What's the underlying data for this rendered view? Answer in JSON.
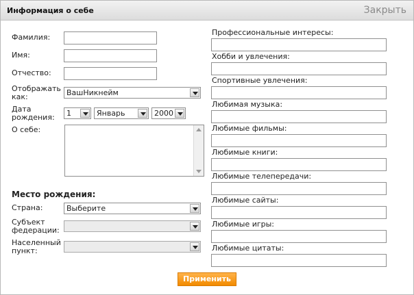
{
  "dialog": {
    "title": "Информация о себе",
    "close_label": "Закрыть",
    "apply_label": "Применить"
  },
  "form": {
    "surname_label": "Фамилия:",
    "name_label": "Имя:",
    "patronymic_label": "Отчество:",
    "display_as_label_1": "Отображать",
    "display_as_label_2": "как:",
    "display_as_value": "ВашНикнейм",
    "birthdate_label_1": "Дата",
    "birthdate_label_2": "рождения:",
    "birth_day": "1",
    "birth_month": "Январь",
    "birth_year": "2000",
    "about_label": "О себе:",
    "birthplace_heading": "Место рождения:",
    "country_label": "Страна:",
    "country_value": "Выберите",
    "region_label_1": "Субъект",
    "region_label_2": "федерации:",
    "region_value": "",
    "city_label_1": "Населенный",
    "city_label_2": "пункт:",
    "city_value": ""
  },
  "interests": [
    {
      "label": "Профессиональные интересы:"
    },
    {
      "label": "Хобби и увлечения:"
    },
    {
      "label": "Спортивные увлечения:"
    },
    {
      "label": "Любимая музыка:"
    },
    {
      "label": "Любимые фильмы:"
    },
    {
      "label": "Любимые книги:"
    },
    {
      "label": "Любимые телепередачи:"
    },
    {
      "label": "Любимые сайты:"
    },
    {
      "label": "Любимые игры:"
    },
    {
      "label": "Любимые цитаты:"
    }
  ],
  "colors": {
    "accent": "#f28a00",
    "titlebar": "#dcdcdc"
  }
}
